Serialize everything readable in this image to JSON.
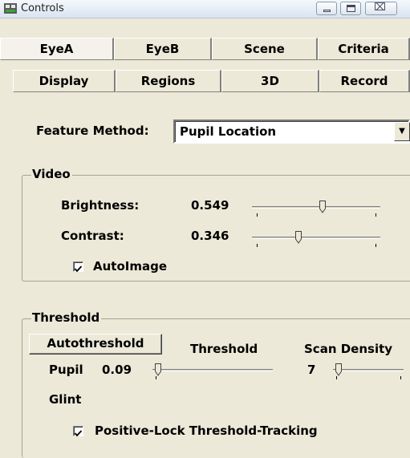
{
  "window": {
    "title": "Controls",
    "icon": "app-icon",
    "controls": {
      "minimize": "minimize-icon",
      "maximize": "maximize-icon",
      "close": "close-icon"
    }
  },
  "tabs": {
    "row1": [
      "EyeA",
      "EyeB",
      "Scene",
      "Criteria"
    ],
    "row2": [
      "Display",
      "Regions",
      "3D",
      "Record"
    ],
    "active": "EyeA"
  },
  "feature": {
    "label": "Feature Method:",
    "value": "Pupil Location",
    "arrow": "▼"
  },
  "video": {
    "group_label": "Video",
    "brightness": {
      "label": "Brightness:",
      "value": "0.549",
      "slider_level": 0.549
    },
    "contrast": {
      "label": "Contrast:",
      "value": "0.346",
      "slider_level": 0.346
    },
    "autoimage": {
      "label": "AutoImage",
      "checked": true
    }
  },
  "threshold": {
    "group_label": "Threshold",
    "auto_button": "Autothreshold",
    "col_threshold": "Threshold",
    "col_scan_density": "Scan Density",
    "pupil": {
      "label": "Pupil",
      "threshold": "0.09",
      "threshold_level": 0.0,
      "scan_density": "7",
      "scan_level": 0.0
    },
    "glint": {
      "label": "Glint"
    },
    "positive_lock": {
      "label": "Positive-Lock Threshold-Tracking",
      "checked": true
    }
  },
  "colors": {
    "face": "#ece9d8",
    "group_border": "#a7a391",
    "title_gradient": "#d9e4f0"
  }
}
